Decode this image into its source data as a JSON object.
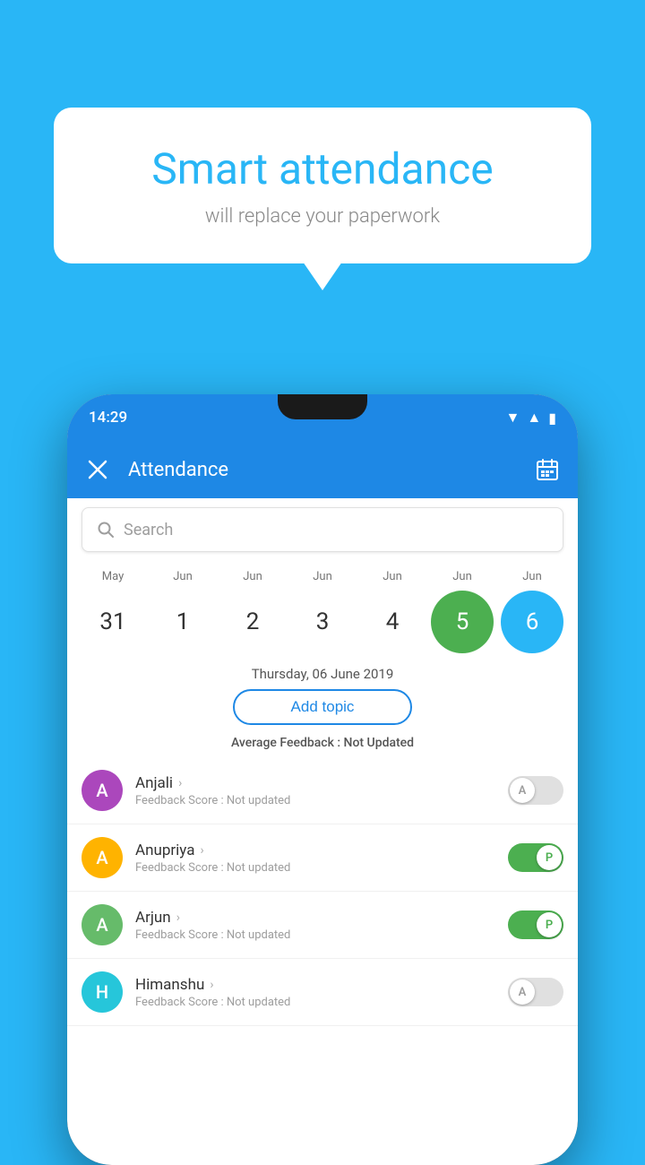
{
  "background_color": "#29b6f6",
  "speech_bubble": {
    "title": "Smart attendance",
    "subtitle": "will replace your paperwork"
  },
  "phone": {
    "status_bar": {
      "time": "14:29",
      "signal_icon": "▼",
      "wifi_icon": "▲",
      "battery_icon": "▮"
    },
    "app_bar": {
      "title": "Attendance",
      "close_icon": "✕",
      "calendar_icon": "📅"
    },
    "search": {
      "placeholder": "Search"
    },
    "calendar": {
      "months": [
        "May",
        "Jun",
        "Jun",
        "Jun",
        "Jun",
        "Jun",
        "Jun"
      ],
      "days": [
        "31",
        "1",
        "2",
        "3",
        "4",
        "5",
        "6"
      ],
      "today_index": 5,
      "selected_index": 6
    },
    "date_label": "Thursday, 06 June 2019",
    "add_topic_label": "Add topic",
    "avg_feedback_label": "Average Feedback : ",
    "avg_feedback_value": "Not Updated",
    "students": [
      {
        "name": "Anjali",
        "avatar_letter": "A",
        "avatar_color": "#ab47bc",
        "feedback": "Feedback Score : Not updated",
        "toggle_state": "off",
        "toggle_label": "A"
      },
      {
        "name": "Anupriya",
        "avatar_letter": "A",
        "avatar_color": "#ffb300",
        "feedback": "Feedback Score : Not updated",
        "toggle_state": "on",
        "toggle_label": "P"
      },
      {
        "name": "Arjun",
        "avatar_letter": "A",
        "avatar_color": "#66bb6a",
        "feedback": "Feedback Score : Not updated",
        "toggle_state": "on",
        "toggle_label": "P"
      },
      {
        "name": "Himanshu",
        "avatar_letter": "H",
        "avatar_color": "#26c6da",
        "feedback": "Feedback Score : Not updated",
        "toggle_state": "off",
        "toggle_label": "A"
      }
    ]
  }
}
